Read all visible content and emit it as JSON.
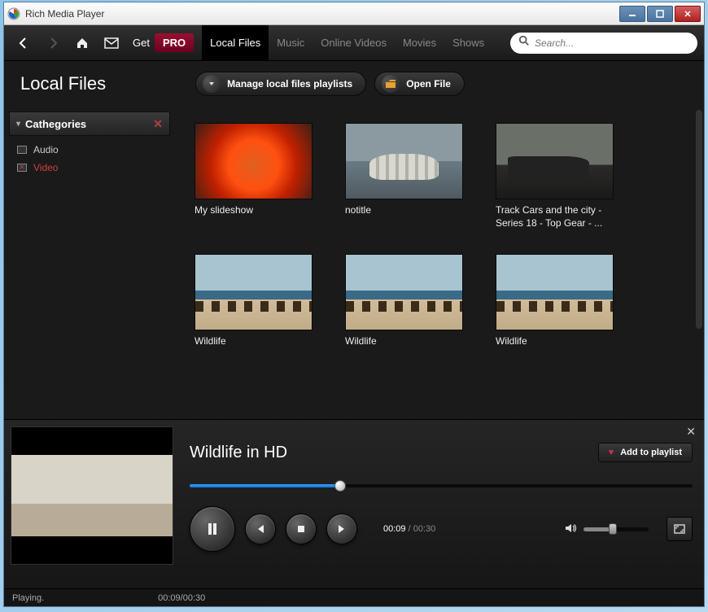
{
  "window": {
    "title": "Rich Media Player"
  },
  "nav": {
    "get": "Get",
    "pro": "PRO",
    "tabs": [
      "Local Files",
      "Music",
      "Online Videos",
      "Movies",
      "Shows"
    ],
    "active_tab": 0,
    "search_placeholder": "Search..."
  },
  "header": {
    "page_title": "Local Files",
    "manage_label": "Manage local files playlists",
    "open_label": "Open File"
  },
  "sidebar": {
    "title": "Cathegories",
    "items": [
      {
        "label": "Audio",
        "active": false
      },
      {
        "label": "Video",
        "active": true
      }
    ]
  },
  "tiles": [
    {
      "label": "My slideshow",
      "art": "flower"
    },
    {
      "label": "notitle",
      "art": "birds"
    },
    {
      "label": "Track Cars and the city - Series 18 - Top Gear - ...",
      "art": "car"
    },
    {
      "label": "Wildlife",
      "art": "horses"
    },
    {
      "label": "Wildlife",
      "art": "horses"
    },
    {
      "label": "Wildlife",
      "art": "horses"
    }
  ],
  "player": {
    "now_playing": "Wildlife in HD",
    "add_playlist": "Add to playlist",
    "current": "00:09",
    "total": "00:30",
    "progress_pct": 30,
    "volume_pct": 45
  },
  "status": {
    "state": "Playing.",
    "time": "00:09/00:30"
  }
}
